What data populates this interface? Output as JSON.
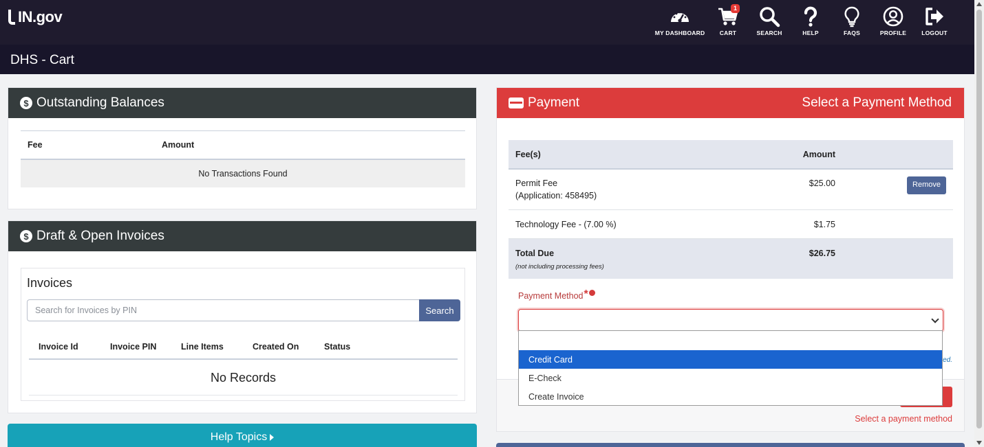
{
  "header": {
    "logo_text": "IN.gov",
    "cart_count": "1",
    "nav": {
      "dashboard": "MY DASHBOARD",
      "cart": "CART",
      "search": "SEARCH",
      "help": "HELP",
      "faqs": "FAQS",
      "profile": "PROFILE",
      "logout": "LOGOUT"
    }
  },
  "page_title": "DHS - Cart",
  "outstanding": {
    "title": "Outstanding Balances",
    "col_fee": "Fee",
    "col_amount": "Amount",
    "empty": "No Transactions Found"
  },
  "invoices": {
    "panel_title": "Draft & Open Invoices",
    "card_title": "Invoices",
    "search_placeholder": "Search for Invoices by PIN",
    "search_button": "Search",
    "columns": [
      "Invoice Id",
      "Invoice PIN",
      "Line Items",
      "Created On",
      "Status"
    ],
    "empty": "No Records"
  },
  "help_topics": "Help Topics",
  "payment": {
    "title": "Payment",
    "subtitle": "Select a Payment Method",
    "col_fees": "Fee(s)",
    "col_amount": "Amount",
    "rows": [
      {
        "name": "Permit Fee",
        "detail": "(Application: 458495)",
        "amount": "$25.00",
        "action": "Remove"
      },
      {
        "name": "Technology Fee - (7.00 %)",
        "amount": "$1.75"
      }
    ],
    "total_label": "Total Due",
    "total_note": "(not including processing fees)",
    "total_amount": "$26.75",
    "method_label": "Payment Method",
    "required_mark": "*",
    "options": [
      "Credit Card",
      "E-Check",
      "Create Invoice"
    ],
    "trailing_fragment": "red.",
    "footer_note": "Select a payment method"
  },
  "colors": {
    "top_bar": "#1f1b2e",
    "panel_header": "#353c3d",
    "payment_header": "#dc3c3c",
    "button_blue": "#4e6597",
    "help_teal": "#17a2b8",
    "option_selected": "#1a64cf"
  }
}
